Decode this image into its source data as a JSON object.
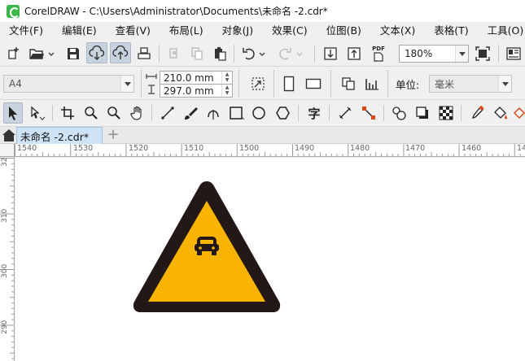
{
  "window": {
    "title": "CorelDRAW - C:\\Users\\Administrator\\Documents\\未命名 -2.cdr*"
  },
  "menu": {
    "items": [
      "文件(F)",
      "编辑(E)",
      "查看(V)",
      "布局(L)",
      "对象(J)",
      "效果(C)",
      "位图(B)",
      "文本(X)",
      "表格(T)",
      "工具(O)"
    ]
  },
  "standard_toolbar": {
    "zoom_value": "180%",
    "pdf_label": "PDF"
  },
  "property_bar": {
    "page_size": "A4",
    "width": "210.0 mm",
    "height": "297.0 mm",
    "unit_label": "单位:",
    "unit_value": "毫米"
  },
  "toolbox": {
    "text_tool_glyph": "字"
  },
  "document_tabs": {
    "active_tab": "未命名 -2.cdr*",
    "add_symbol": "+"
  },
  "ruler": {
    "horizontal_labels": [
      "1540",
      "1530",
      "1520",
      "1510",
      "1500",
      "1490",
      "1480",
      "1470",
      "1460",
      "14"
    ],
    "vertical_labels": [
      "32",
      "310",
      "300",
      "290"
    ],
    "unit": "毫米"
  },
  "drawing": {
    "sign_border_color": "#231815",
    "sign_fill_color": "#f8b400",
    "sign_symbol": "vehicle"
  }
}
